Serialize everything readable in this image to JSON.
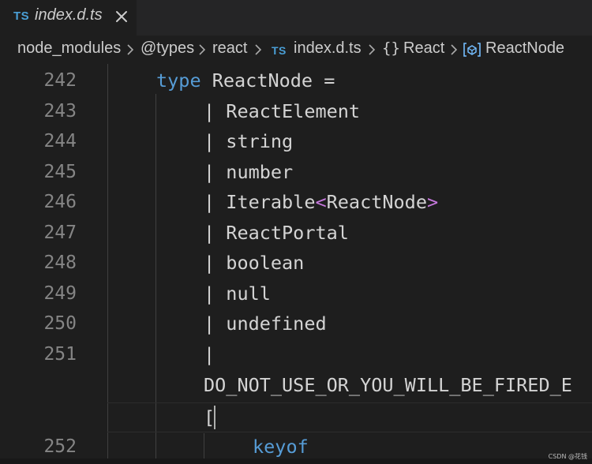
{
  "tab": {
    "badge": "TS",
    "title": "index.d.ts",
    "close_glyph": "close-icon"
  },
  "breadcrumb": {
    "items": [
      "node_modules",
      "@types",
      "react",
      "index.d.ts",
      "React",
      "ReactNode"
    ],
    "file_badge": "TS",
    "namespace_icon": "{}",
    "variable_icon": "symbol-variable-icon"
  },
  "editor": {
    "lines": [
      {
        "no": "242",
        "tokens": [
          {
            "t": "type",
            "c": "kw"
          },
          {
            "t": " ReactNode ="
          }
        ]
      },
      {
        "no": "243",
        "tokens": [
          {
            "t": "| ReactElement"
          }
        ]
      },
      {
        "no": "244",
        "tokens": [
          {
            "t": "| string"
          }
        ]
      },
      {
        "no": "245",
        "tokens": [
          {
            "t": "| number"
          }
        ]
      },
      {
        "no": "246",
        "tokens": [
          {
            "t": "| Iterable"
          },
          {
            "t": "<",
            "c": "bracket"
          },
          {
            "t": "ReactNode"
          },
          {
            "t": ">",
            "c": "bracket"
          }
        ]
      },
      {
        "no": "247",
        "tokens": [
          {
            "t": "| ReactPortal"
          }
        ]
      },
      {
        "no": "248",
        "tokens": [
          {
            "t": "| boolean"
          }
        ]
      },
      {
        "no": "249",
        "tokens": [
          {
            "t": "| null"
          }
        ]
      },
      {
        "no": "250",
        "tokens": [
          {
            "t": "| undefined"
          }
        ]
      },
      {
        "no": "251",
        "tokens": [
          {
            "t": "|"
          }
        ]
      },
      {
        "no": "",
        "tokens": [
          {
            "t": "DO_NOT_USE_OR_YOU_WILL_BE_FIRED_E"
          }
        ]
      },
      {
        "no": "",
        "tokens": [
          {
            "t": "[",
            "c": "bracket"
          }
        ]
      },
      {
        "no": "252",
        "tokens": [
          {
            "t": "keyof",
            "c": "kw"
          }
        ]
      }
    ]
  },
  "colors": {
    "background": "#1e1e1e",
    "keyword": "#569cd6",
    "bracket": "#c678dd",
    "text": "#d4d4d4",
    "line_number": "#858585",
    "ts_badge": "#4a9fd6"
  },
  "watermark": "CSDN @花钱"
}
